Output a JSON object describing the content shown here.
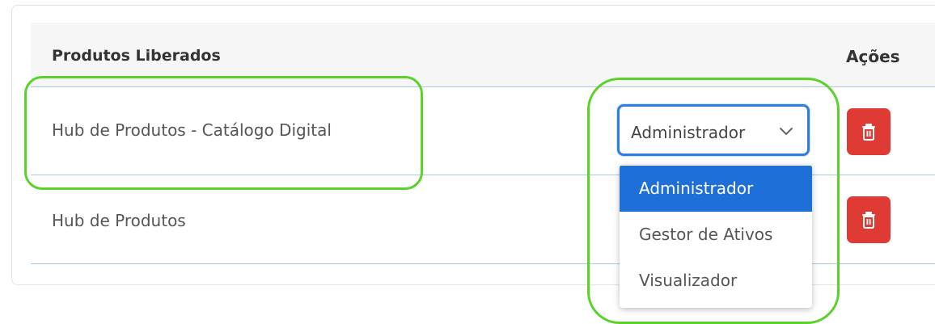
{
  "table": {
    "header_products": "Produtos Liberados",
    "header_actions": "Ações",
    "rows": [
      {
        "product": "Hub de Produtos - Catálogo Digital",
        "role": "Administrador"
      },
      {
        "product": "Hub de Produtos"
      }
    ]
  },
  "dropdown": {
    "selected": "Administrador",
    "options": [
      "Administrador",
      "Gestor de Ativos",
      "Visualizador"
    ]
  },
  "colors": {
    "select_border": "#2e7de0",
    "option_highlight": "#1f6fd9",
    "delete_button": "#e03a34",
    "annotation_outline": "#5ad22b"
  },
  "icons": {
    "select_chevron": "chevron-down-icon",
    "delete": "trash-icon"
  }
}
